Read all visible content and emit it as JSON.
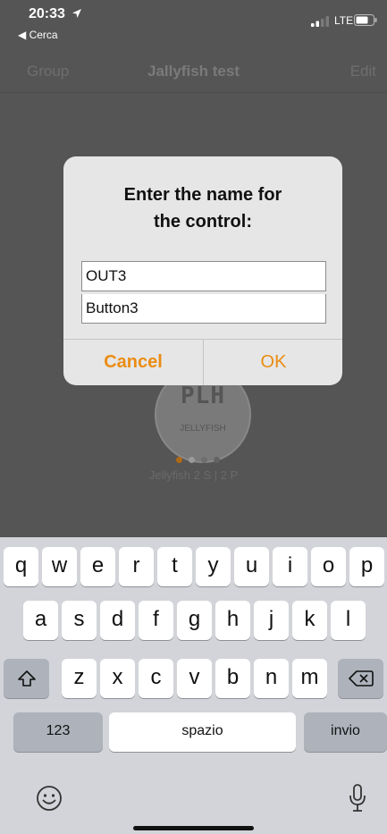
{
  "status_bar": {
    "time": "20:33",
    "back_app": "◀ Cerca",
    "network": "LTE"
  },
  "nav": {
    "left": "Group",
    "title": "Jallyfish test",
    "right": "Edit"
  },
  "device": {
    "logo": "PLH",
    "brand": "JELLYFISH",
    "caption": "Jellyfish 2 S | 2 P"
  },
  "alert": {
    "title_line1": "Enter the name for",
    "title_line2": "the control:",
    "field1_value": "OUT3",
    "field2_value": "Button3",
    "cancel_label": "Cancel",
    "ok_label": "OK"
  },
  "keyboard": {
    "row1": [
      "q",
      "w",
      "e",
      "r",
      "t",
      "y",
      "u",
      "i",
      "o",
      "p"
    ],
    "row2": [
      "a",
      "s",
      "d",
      "f",
      "g",
      "h",
      "j",
      "k",
      "l"
    ],
    "row3": [
      "z",
      "x",
      "c",
      "v",
      "b",
      "n",
      "m"
    ],
    "numbers_label": "123",
    "space_label": "spazio",
    "return_label": "invio"
  },
  "colors": {
    "accent": "#ea8d12",
    "background": "#555555",
    "keyboard": "#d2d4d9"
  }
}
